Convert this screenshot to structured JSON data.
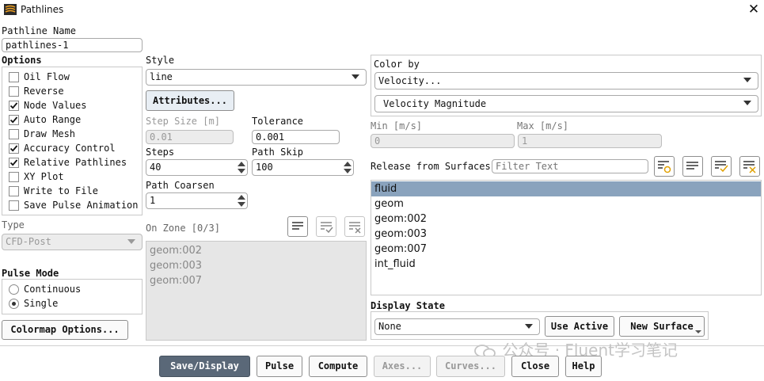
{
  "window": {
    "title": "Pathlines",
    "close_icon": "close-icon"
  },
  "pathline_name": {
    "label": "Pathline Name",
    "value": "pathlines-1"
  },
  "options": {
    "label": "Options",
    "items": [
      {
        "label": "Oil Flow",
        "checked": false
      },
      {
        "label": "Reverse",
        "checked": false
      },
      {
        "label": "Node Values",
        "checked": true
      },
      {
        "label": "Auto Range",
        "checked": true
      },
      {
        "label": "Draw Mesh",
        "checked": false
      },
      {
        "label": "Accuracy Control",
        "checked": true
      },
      {
        "label": "Relative Pathlines",
        "checked": true
      },
      {
        "label": "XY Plot",
        "checked": false
      },
      {
        "label": "Write to File",
        "checked": false
      },
      {
        "label": "Save Pulse Animation",
        "checked": false
      }
    ]
  },
  "type": {
    "label": "Type",
    "value": "CFD-Post"
  },
  "pulse_mode": {
    "label": "Pulse Mode",
    "options": [
      {
        "label": "Continuous",
        "selected": false
      },
      {
        "label": "Single",
        "selected": true
      }
    ]
  },
  "colormap_button": "Colormap Options...",
  "style": {
    "label": "Style",
    "value": "line",
    "attributes_button": "Attributes..."
  },
  "step_size": {
    "label": "Step Size [m]",
    "value": "0.01"
  },
  "tolerance": {
    "label": "Tolerance",
    "value": "0.001"
  },
  "steps": {
    "label": "Steps",
    "value": "40"
  },
  "path_skip": {
    "label": "Path Skip",
    "value": "100"
  },
  "path_coarsen": {
    "label": "Path Coarsen",
    "value": "1"
  },
  "on_zone": {
    "label": "On Zone [0/3]",
    "items": [
      "geom:002",
      "geom:003",
      "geom:007"
    ]
  },
  "color_by": {
    "label": "Color by",
    "value1": "Velocity...",
    "value2": "Velocity Magnitude"
  },
  "min": {
    "label": "Min [m/s]",
    "value": "0"
  },
  "max": {
    "label": "Max [m/s]",
    "value": "1"
  },
  "release": {
    "label": "Release from Surfaces",
    "filter_placeholder": "Filter Text",
    "items": [
      {
        "label": "fluid",
        "selected": true
      },
      {
        "label": "geom",
        "selected": false
      },
      {
        "label": "geom:002",
        "selected": false
      },
      {
        "label": "geom:003",
        "selected": false
      },
      {
        "label": "geom:007",
        "selected": false
      },
      {
        "label": "int_fluid",
        "selected": false
      }
    ]
  },
  "display_state": {
    "label": "Display State",
    "value": "None",
    "use_active": "Use Active",
    "new_surface": "New Surface"
  },
  "bottom_buttons": {
    "save_display": "Save/Display",
    "pulse": "Pulse",
    "compute": "Compute",
    "axes": "Axes...",
    "curves": "Curves...",
    "close": "Close",
    "help": "Help"
  },
  "watermark": "公众号 · Fluent学习笔记"
}
